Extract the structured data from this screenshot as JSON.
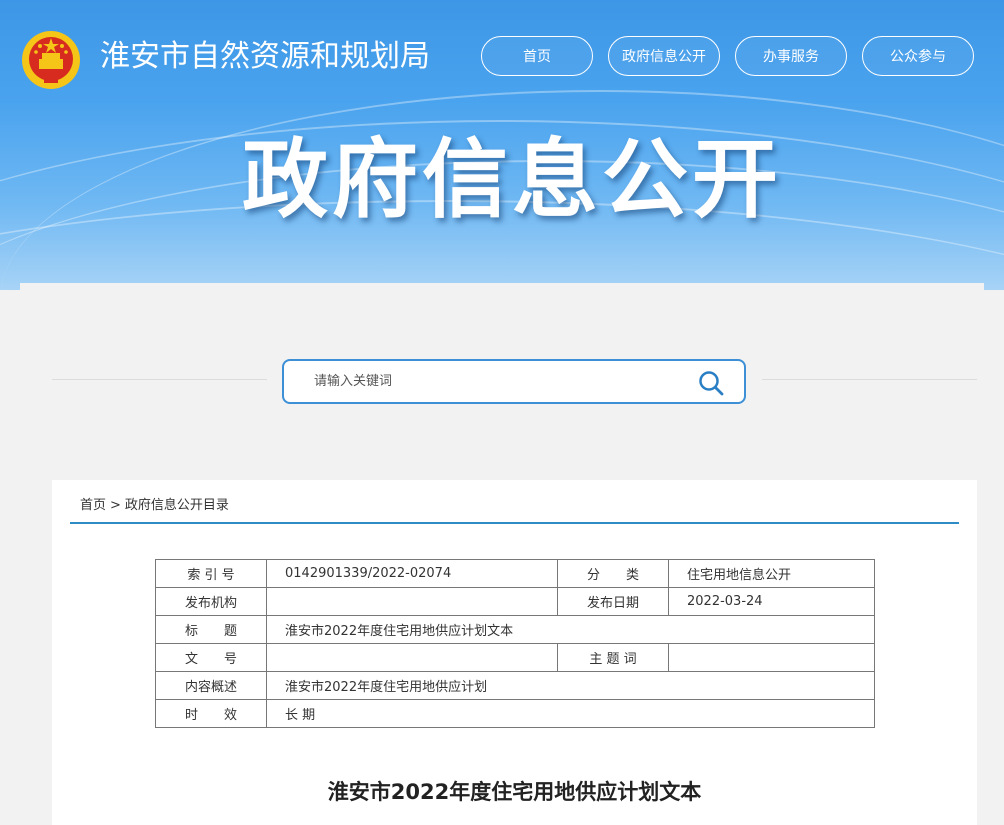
{
  "header": {
    "site_title": "淮安市自然资源和规划局",
    "banner_title": "政府信息公开",
    "nav": [
      {
        "label": "首页"
      },
      {
        "label": "政府信息公开"
      },
      {
        "label": "办事服务"
      },
      {
        "label": "公众参与"
      }
    ]
  },
  "search": {
    "placeholder": "请输入关键词",
    "value": ""
  },
  "breadcrumb": {
    "home": "首页",
    "separator": ">",
    "current": "政府信息公开目录"
  },
  "meta_table": {
    "index_label": "索 引 号",
    "index_value": "0142901339/2022-02074",
    "category_label": "分　　类",
    "category_value": "住宅用地信息公开",
    "publisher_label": "发布机构",
    "publisher_value": "",
    "date_label": "发布日期",
    "date_value": "2022-03-24",
    "title_label": "标　　题",
    "title_value": "淮安市2022年度住宅用地供应计划文本",
    "docno_label": "文　　号",
    "docno_value": "",
    "keywords_label": "主 题 词",
    "keywords_value": "",
    "summary_label": "内容概述",
    "summary_value": "淮安市2022年度住宅用地供应计划",
    "validity_label": "时　　效",
    "validity_value": "长 期"
  },
  "document": {
    "title": "淮安市2022年度住宅用地供应计划文本"
  },
  "colors": {
    "accent": "#3d8fd6",
    "header_blue": "#4aa3ee",
    "crumb_line": "#2d8cc4",
    "emblem_red": "#d62b1e",
    "emblem_gold": "#f5c518"
  },
  "icons": {
    "emblem": "national-emblem-icon",
    "search": "search-icon"
  }
}
